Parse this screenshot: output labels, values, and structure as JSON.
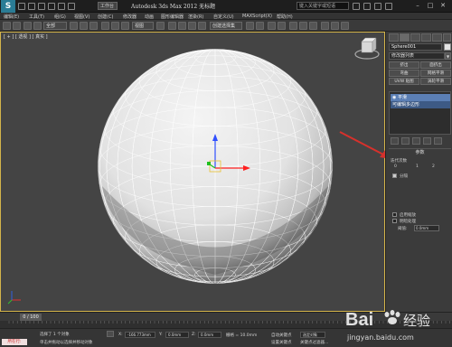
{
  "titlebar": {
    "logo_letter": "S",
    "workspace": "工作台",
    "title": "Autodesk 3ds Max 2012   无标题",
    "search_placeholder": "键入关键字或短语",
    "minimize": "–",
    "maximize": "□",
    "close": "✕"
  },
  "menu": [
    "编辑(E)",
    "工具(T)",
    "组(G)",
    "视图(V)",
    "创建(C)",
    "修改器",
    "动画",
    "图形编辑器",
    "渲染(R)",
    "自定义(U)",
    "MAXScript(X)",
    "帮助(H)"
  ],
  "toolbar": {
    "selection_filter": "全部",
    "view_dropdown": "视图",
    "selection_set": "创建选择集"
  },
  "viewport": {
    "label": "[ + ] [ 透视 ] [ 真实 ]",
    "arrow_color": "#d6312c",
    "sphere_color": "#e6e6e6"
  },
  "command_panel": {
    "object_name": "Sphere001",
    "modifier_list": "修改器列表",
    "modifier_buttons": [
      "挤出",
      "面挤出",
      "弯曲",
      "网格平滑",
      "UVW 贴图",
      "涡轮平滑",
      "网格选择",
      "UVW 展开"
    ],
    "stack_items": [
      "可编辑多边形",
      "可编辑多边形"
    ],
    "stack_top": "平滑",
    "rollout_title": "参数",
    "subsection": "迭代次数",
    "iterations_options": [
      "0",
      "1",
      "2"
    ],
    "checkbox_1": "分隔",
    "checkbox_2": "启用缩放",
    "checkbox_3": "明暗处理",
    "spinner_label": "阈值:",
    "spinner_value": "0.0mm"
  },
  "timeline": {
    "frame_counter": "0 / 100"
  },
  "status": {
    "listener_label": "所在行:",
    "selected_text": "选择了 1 个对象",
    "hint_text": "单击并拖动以选择并移动对象",
    "x_label": "X:",
    "x_value": "-166.773mm",
    "y_label": "Y:",
    "y_value": "0.0mm",
    "z_label": "Z:",
    "z_value": "0.0mm",
    "grid": "栅格 = 10.0mm",
    "auto_key": "自动关键点",
    "set_key": "设置关键点",
    "selected_dropdown": "选定对象",
    "key_filters": "关键点过滤器..."
  },
  "watermark": {
    "brand": "Bai",
    "brand_cn": "经验",
    "url": "jingyan.baidu.com"
  }
}
